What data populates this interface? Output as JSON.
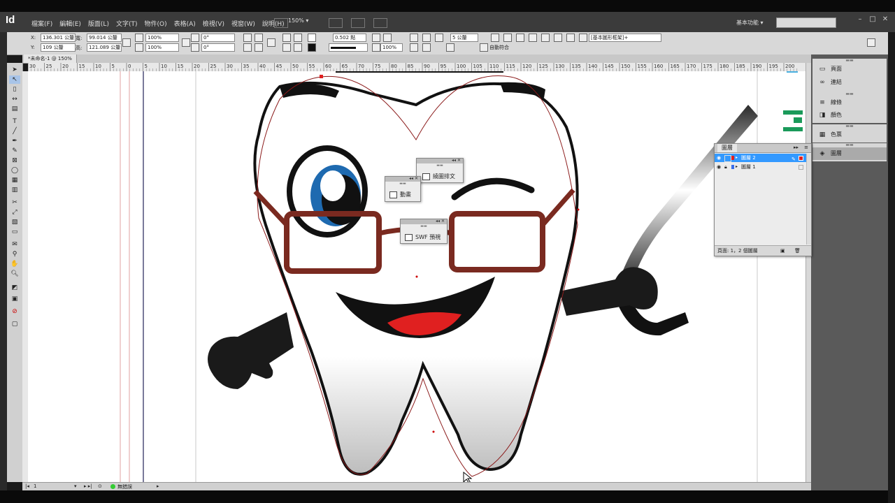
{
  "app": {
    "logo": "Id",
    "menus": [
      "檔案(F)",
      "編輯(E)",
      "版面(L)",
      "文字(T)",
      "物件(O)",
      "表格(A)",
      "檢視(V)",
      "視窗(W)",
      "說明(H)"
    ],
    "zoom": "150%",
    "workspace": "基本功能"
  },
  "control": {
    "x_label": "X:",
    "x_value": "136.301 公釐",
    "y_label": "Y:",
    "y_value": "109 公釐",
    "w_label": "寬:",
    "w_value": "99.014 公釐",
    "h_label": "高:",
    "h_value": "121.089 公釐",
    "scale_x": "100%",
    "scale_y": "100%",
    "rotate": "0°",
    "shear": "0°",
    "stroke_weight": "0.502 點",
    "opacity": "100%",
    "gap": "5 公釐",
    "auto_fit": "自動符合",
    "object_style": "[基本圖形框架]+"
  },
  "document": {
    "tab_title": "*未命名-1 @ 150%",
    "ruler_labels": [
      "30",
      "25",
      "20",
      "15",
      "10",
      "5",
      "0",
      "5",
      "10",
      "15",
      "20",
      "25",
      "30",
      "35",
      "40",
      "45",
      "50",
      "55",
      "60",
      "65",
      "70",
      "75",
      "80",
      "85",
      "90",
      "95",
      "100",
      "105",
      "110",
      "115",
      "120",
      "125",
      "130",
      "135",
      "140",
      "145",
      "150",
      "155",
      "160",
      "165",
      "170",
      "175",
      "180",
      "185",
      "190",
      "195",
      "200"
    ]
  },
  "status": {
    "page": "1",
    "preflight": "無錯誤"
  },
  "dock": {
    "items": [
      {
        "icon": "pages-icon",
        "label": "頁面"
      },
      {
        "icon": "links-icon",
        "label": "連結"
      },
      {
        "icon": "stroke-icon",
        "label": "線條"
      },
      {
        "icon": "color-icon",
        "label": "顏色"
      },
      {
        "icon": "swatches-icon",
        "label": "色票"
      },
      {
        "icon": "layers-icon",
        "label": "圖層"
      }
    ]
  },
  "layers": {
    "tab": "圖層",
    "rows": [
      {
        "name": "圖層 2",
        "selected": true,
        "color": "#e02020"
      },
      {
        "name": "圖層 1",
        "selected": false,
        "color": "#3a6ee8"
      }
    ],
    "footer": "頁面: 1，2 個圖層"
  },
  "floating_panels": {
    "text_wrap": "繞圖排文",
    "animation": "動畫",
    "swf_preview": "SWF 預視"
  },
  "colors": {
    "accent_selected": "#3399ff",
    "path_red": "#8b1a1a",
    "glasses": "#7a2a20",
    "eye_blue": "#1e6ab0"
  }
}
